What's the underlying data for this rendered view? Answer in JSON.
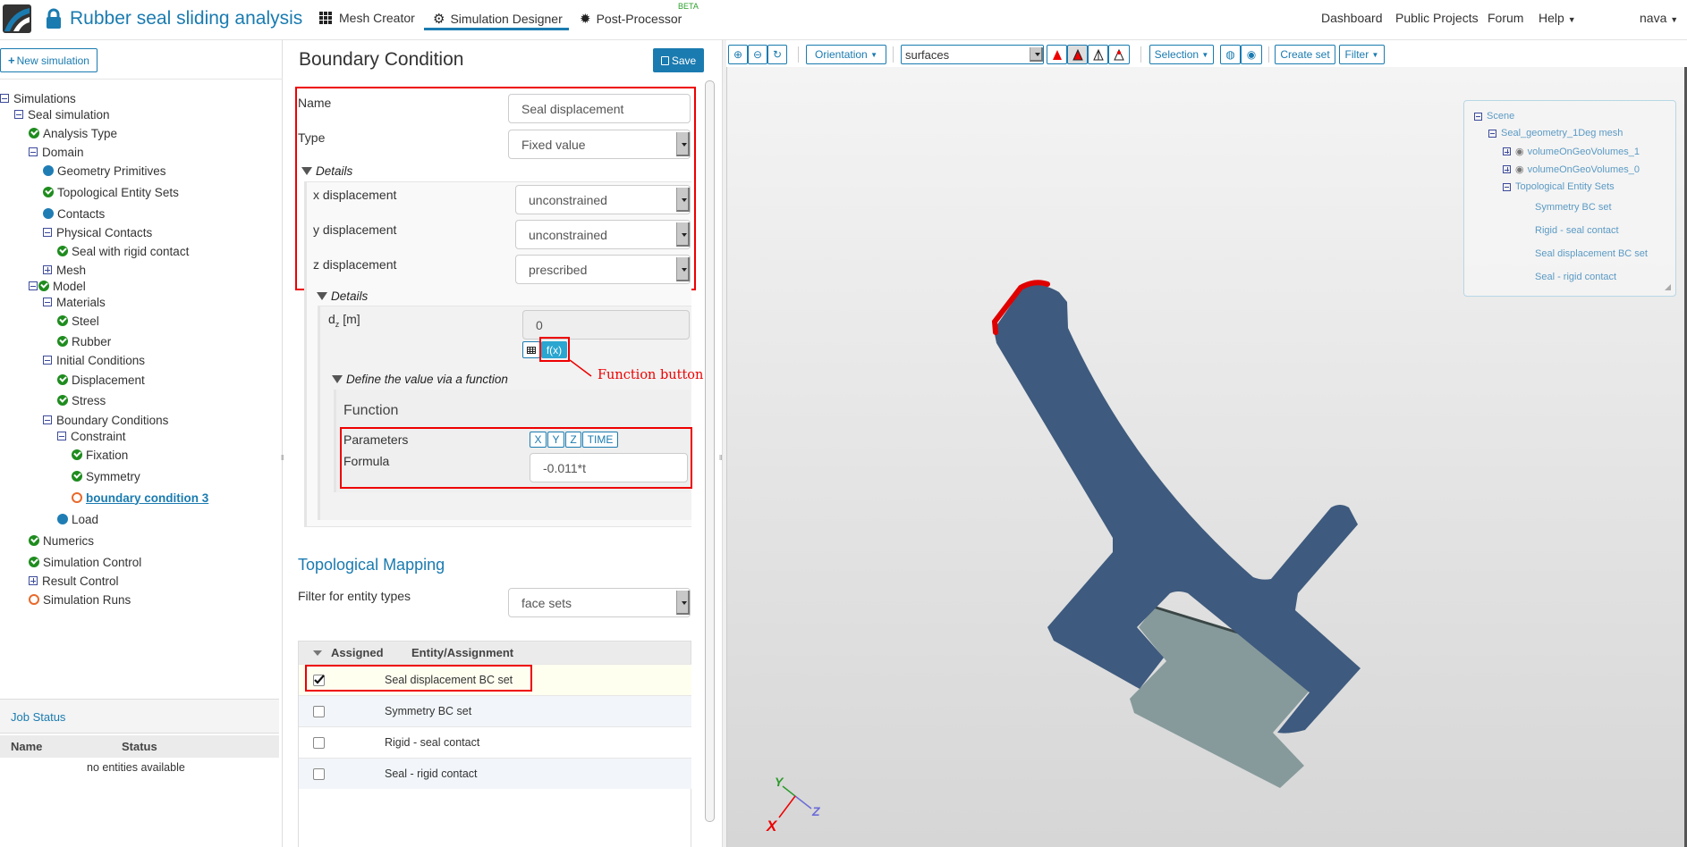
{
  "header": {
    "app_title": "Rubber seal sliding analysis",
    "tabs": [
      {
        "label": "Mesh Creator",
        "icon": "grid-icon"
      },
      {
        "label": "Simulation Designer",
        "icon": "gears-icon",
        "active": true
      },
      {
        "label": "Post-Processor",
        "icon": "cog-icon",
        "badge": "BETA"
      }
    ],
    "links": [
      "Dashboard",
      "Public Projects",
      "Forum",
      "Help"
    ],
    "user": "nava"
  },
  "sidebar": {
    "new_simulation": "New simulation",
    "tree": [
      {
        "label": "Simulations",
        "depth": 0,
        "icon": "minus"
      },
      {
        "label": "Seal simulation",
        "depth": 1,
        "icon": "minus"
      },
      {
        "label": "Analysis Type",
        "depth": 2,
        "icon": "check"
      },
      {
        "label": "Domain",
        "depth": 2,
        "icon": "minus"
      },
      {
        "label": "Geometry Primitives",
        "depth": 3,
        "icon": "dot"
      },
      {
        "label": "Topological Entity Sets",
        "depth": 3,
        "icon": "check"
      },
      {
        "label": "Contacts",
        "depth": 3,
        "icon": "dot"
      },
      {
        "label": "Physical Contacts",
        "depth": 3,
        "icon": "minus"
      },
      {
        "label": "Seal with rigid contact",
        "depth": 4,
        "icon": "check"
      },
      {
        "label": "Mesh",
        "depth": 3,
        "icon": "plus"
      },
      {
        "label": "Model",
        "depth": 2,
        "icon": "minus-check"
      },
      {
        "label": "Materials",
        "depth": 3,
        "icon": "minus"
      },
      {
        "label": "Steel",
        "depth": 4,
        "icon": "check"
      },
      {
        "label": "Rubber",
        "depth": 4,
        "icon": "check"
      },
      {
        "label": "Initial Conditions",
        "depth": 3,
        "icon": "minus"
      },
      {
        "label": "Displacement",
        "depth": 4,
        "icon": "check"
      },
      {
        "label": "Stress",
        "depth": 4,
        "icon": "check"
      },
      {
        "label": "Boundary Conditions",
        "depth": 3,
        "icon": "minus"
      },
      {
        "label": "Constraint",
        "depth": 4,
        "icon": "minus"
      },
      {
        "label": "Fixation",
        "depth": 5,
        "icon": "check"
      },
      {
        "label": "Symmetry",
        "depth": 5,
        "icon": "check"
      },
      {
        "label": "boundary condition 3",
        "depth": 5,
        "icon": "ring",
        "active": true
      },
      {
        "label": "Load",
        "depth": 4,
        "icon": "dot"
      },
      {
        "label": "Numerics",
        "depth": 2,
        "icon": "check"
      },
      {
        "label": "Simulation Control",
        "depth": 2,
        "icon": "check"
      },
      {
        "label": "Result Control",
        "depth": 2,
        "icon": "plus"
      },
      {
        "label": "Simulation Runs",
        "depth": 2,
        "icon": "ring"
      }
    ],
    "job_status": {
      "title": "Job Status",
      "columns": [
        "Name",
        "Status"
      ],
      "empty": "no entities available"
    }
  },
  "form": {
    "title": "Boundary Condition",
    "save": "Save",
    "name_label": "Name",
    "name_value": "Seal displacement",
    "type_label": "Type",
    "type_value": "Fixed value",
    "details_label": "Details",
    "x_label": "x displacement",
    "x_value": "unconstrained",
    "y_label": "y displacement",
    "y_value": "unconstrained",
    "z_label": "z displacement",
    "z_value": "prescribed",
    "details2_label": "Details",
    "dz_label": "d",
    "dz_sub": "z",
    "dz_unit": "[m]",
    "dz_value": "0",
    "fx_button": "f(x)",
    "define_label": "Define the value via a function",
    "function_title": "Function",
    "parameters_label": "Parameters",
    "parameters": [
      "X",
      "Y",
      "Z",
      "TIME"
    ],
    "formula_label": "Formula",
    "formula_value": "-0.011*t",
    "annotation": "Function button"
  },
  "mapping": {
    "title": "Topological Mapping",
    "filter_label": "Filter for entity types",
    "filter_value": "face sets",
    "columns": [
      "Assigned",
      "Entity/Assignment"
    ],
    "rows": [
      {
        "label": "Seal displacement BC set",
        "checked": true
      },
      {
        "label": "Symmetry BC set",
        "checked": false
      },
      {
        "label": "Rigid - seal contact",
        "checked": false
      },
      {
        "label": "Seal - rigid contact",
        "checked": false
      }
    ]
  },
  "viewer": {
    "toolbar": {
      "orientation": "Orientation",
      "render_mode": "surfaces",
      "selection": "Selection",
      "create_set": "Create set",
      "filter": "Filter"
    },
    "scene": {
      "root": "Scene",
      "mesh": "Seal_geometry_1Deg mesh",
      "volumes": [
        "volumeOnGeoVolumes_1",
        "volumeOnGeoVolumes_0"
      ],
      "sets_title": "Topological Entity Sets",
      "sets": [
        "Symmetry BC set",
        "Rigid - seal contact",
        "Seal displacement BC set",
        "Seal - rigid contact"
      ]
    },
    "axes": {
      "x": "X",
      "y": "Y",
      "z": "Z"
    },
    "colors": {
      "seal": "#3e5a7e",
      "rigid": "#879a9b",
      "selected_face": "#e00000"
    }
  }
}
